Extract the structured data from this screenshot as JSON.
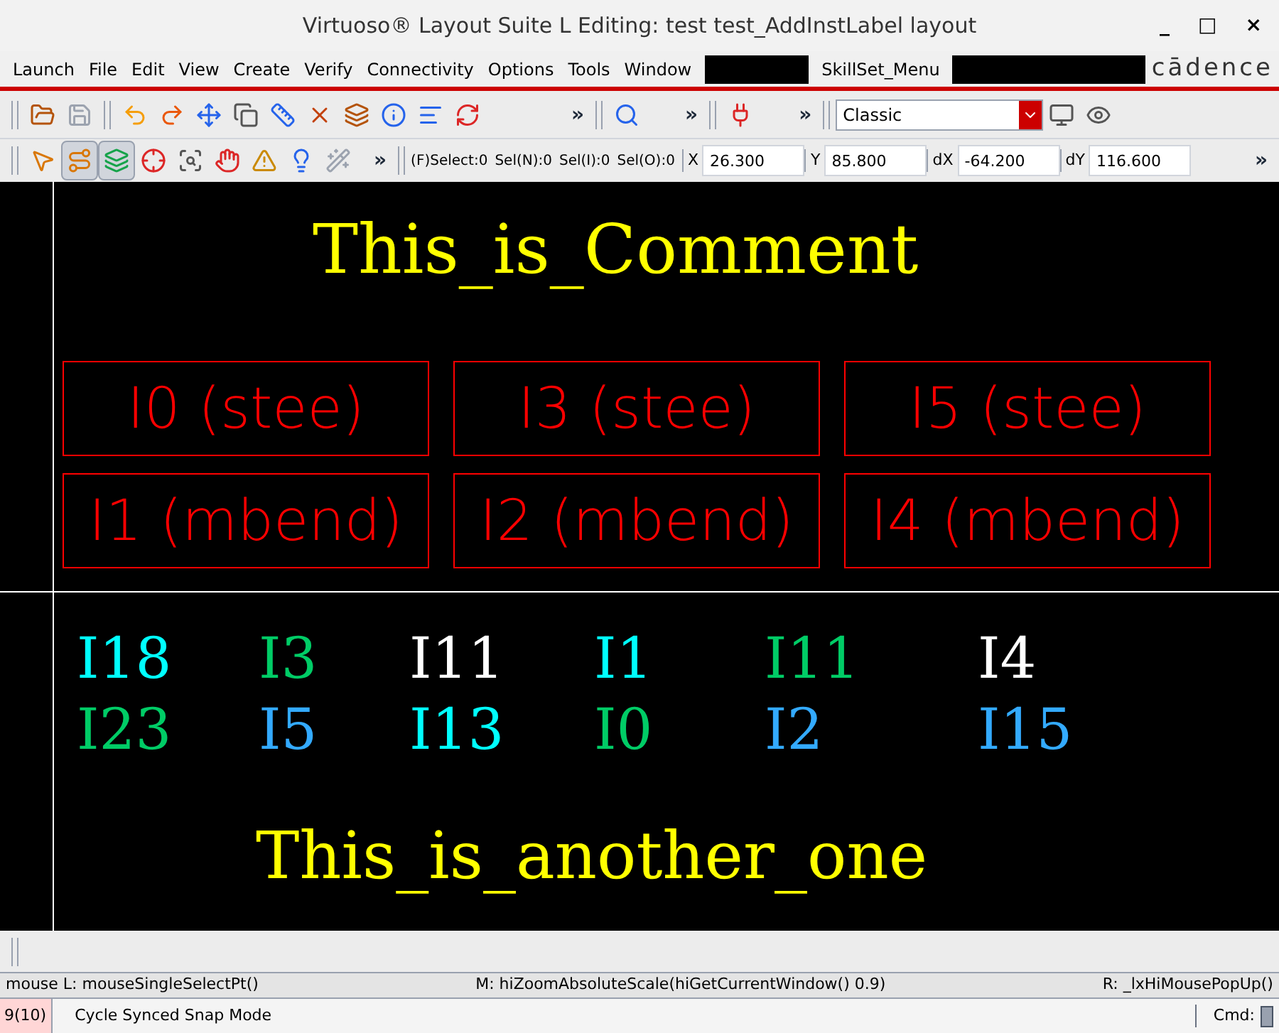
{
  "window": {
    "title": "Virtuoso® Layout Suite L Editing: test test_AddInstLabel layout",
    "controls": [
      "_",
      "□",
      "×"
    ]
  },
  "menu": {
    "items": [
      "Launch",
      "File",
      "Edit",
      "View",
      "Create",
      "Verify",
      "Connectivity",
      "Options",
      "Tools",
      "Window"
    ],
    "extra": "SkillSet_Menu",
    "logo": "cādence"
  },
  "toolbar1": {
    "more": [
      "»",
      "»",
      "»"
    ],
    "view_select": {
      "value": "Classic"
    }
  },
  "toolbar2": {
    "tools": [
      {
        "pressed": false
      },
      {
        "pressed": true
      },
      {
        "pressed": true
      },
      {
        "pressed": false
      },
      {
        "pressed": false
      },
      {
        "pressed": false
      },
      {
        "pressed": false
      },
      {
        "pressed": false
      },
      {
        "pressed": false
      }
    ],
    "more": "»",
    "counts": [
      "(F)Select:0",
      "Sel(N):0",
      "Sel(I):0",
      "Sel(O):0"
    ],
    "coords": [
      {
        "label": "X",
        "value": "26.300"
      },
      {
        "label": "Y",
        "value": "85.800"
      },
      {
        "label": "dX",
        "value": "-64.200"
      },
      {
        "label": "dY",
        "value": "116.600"
      }
    ],
    "end_more": "»"
  },
  "canvas": {
    "top_comment": "This_is_Comment",
    "instances": [
      "I0 (stee)",
      "I3 (stee)",
      "I5 (stee)",
      "I1 (mbend)",
      "I2 (mbend)",
      "I4 (mbend)"
    ],
    "labels": [
      {
        "text": "I18",
        "color": "#00ffff"
      },
      {
        "text": "I3",
        "color": "#00cc66"
      },
      {
        "text": "I11",
        "color": "#ffffff"
      },
      {
        "text": "I1",
        "color": "#00ffff"
      },
      {
        "text": "I11",
        "color": "#00cc66"
      },
      {
        "text": "I4",
        "color": "#ffffff"
      },
      {
        "text": "I23",
        "color": "#00cc66"
      },
      {
        "text": "I5",
        "color": "#33aaff"
      },
      {
        "text": "I13",
        "color": "#00ffff"
      },
      {
        "text": "I0",
        "color": "#00cc66"
      },
      {
        "text": "I2",
        "color": "#33aaff"
      },
      {
        "text": "I15",
        "color": "#33aaff"
      }
    ],
    "bottom_comment": "This_is_another_one"
  },
  "mouse_bar": {
    "left": "mouse L: mouseSingleSelectPt()",
    "middle": "M: hiZoomAbsoluteScale(hiGetCurrentWindow() 0.9)",
    "right": "R: _lxHiMousePopUp()"
  },
  "status_bar": {
    "count": "9(10)",
    "message": "Cycle Synced Snap Mode",
    "cmd_label": "Cmd:"
  }
}
